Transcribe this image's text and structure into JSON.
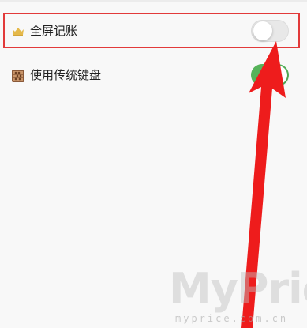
{
  "settings": {
    "items": [
      {
        "label": "全屏记账",
        "icon": "crown-icon",
        "toggle_state": "off",
        "highlighted": true
      },
      {
        "label": "使用传统键盘",
        "icon": "abacus-icon",
        "toggle_state": "on",
        "highlighted": false
      }
    ]
  },
  "watermark": {
    "brand": "MyPrice",
    "domain": "myprice.com.cn"
  },
  "colors": {
    "highlight_box": "#e23a3a",
    "arrow": "#ee1c1c",
    "toggle_on": "#56b35a",
    "toggle_off": "#e8e8e8"
  }
}
